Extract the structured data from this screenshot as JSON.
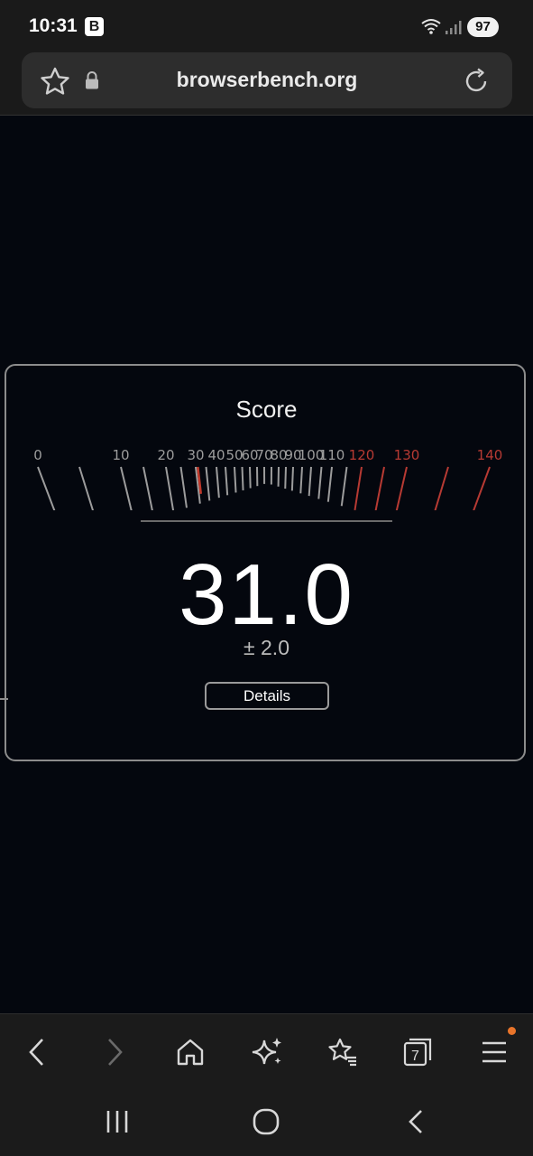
{
  "status_bar": {
    "time": "10:31",
    "badge": "B",
    "battery": "97",
    "icons": [
      "wifi-icon",
      "signal-icon"
    ]
  },
  "url_bar": {
    "url": "browserbench.org",
    "icons": [
      "star-icon",
      "lock-icon",
      "reload-icon"
    ]
  },
  "score": {
    "title": "Score",
    "value": "31.0",
    "error": "± 2.0",
    "details_label": "Details",
    "gauge_needle_value": 31.0,
    "gauge_labels": [
      "0",
      "10",
      "20",
      "30",
      "40",
      "50",
      "60",
      "70",
      "80",
      "90",
      "100",
      "110",
      "120",
      "130",
      "140"
    ],
    "gauge_red_start": 120,
    "colors": {
      "normal": "#9c9c9c",
      "red": "#b73a33",
      "needle": "#c0392b"
    }
  },
  "browser_toolbar": {
    "buttons": [
      "back-icon",
      "forward-icon",
      "home-icon",
      "sparkle-icon",
      "bookmarks-icon",
      "tabs-icon",
      "menu-icon"
    ],
    "tab_count": "7",
    "accent": "#e8742a"
  },
  "nav_bar": {
    "buttons": [
      "recents-icon",
      "home-circle-icon",
      "back-icon"
    ]
  }
}
